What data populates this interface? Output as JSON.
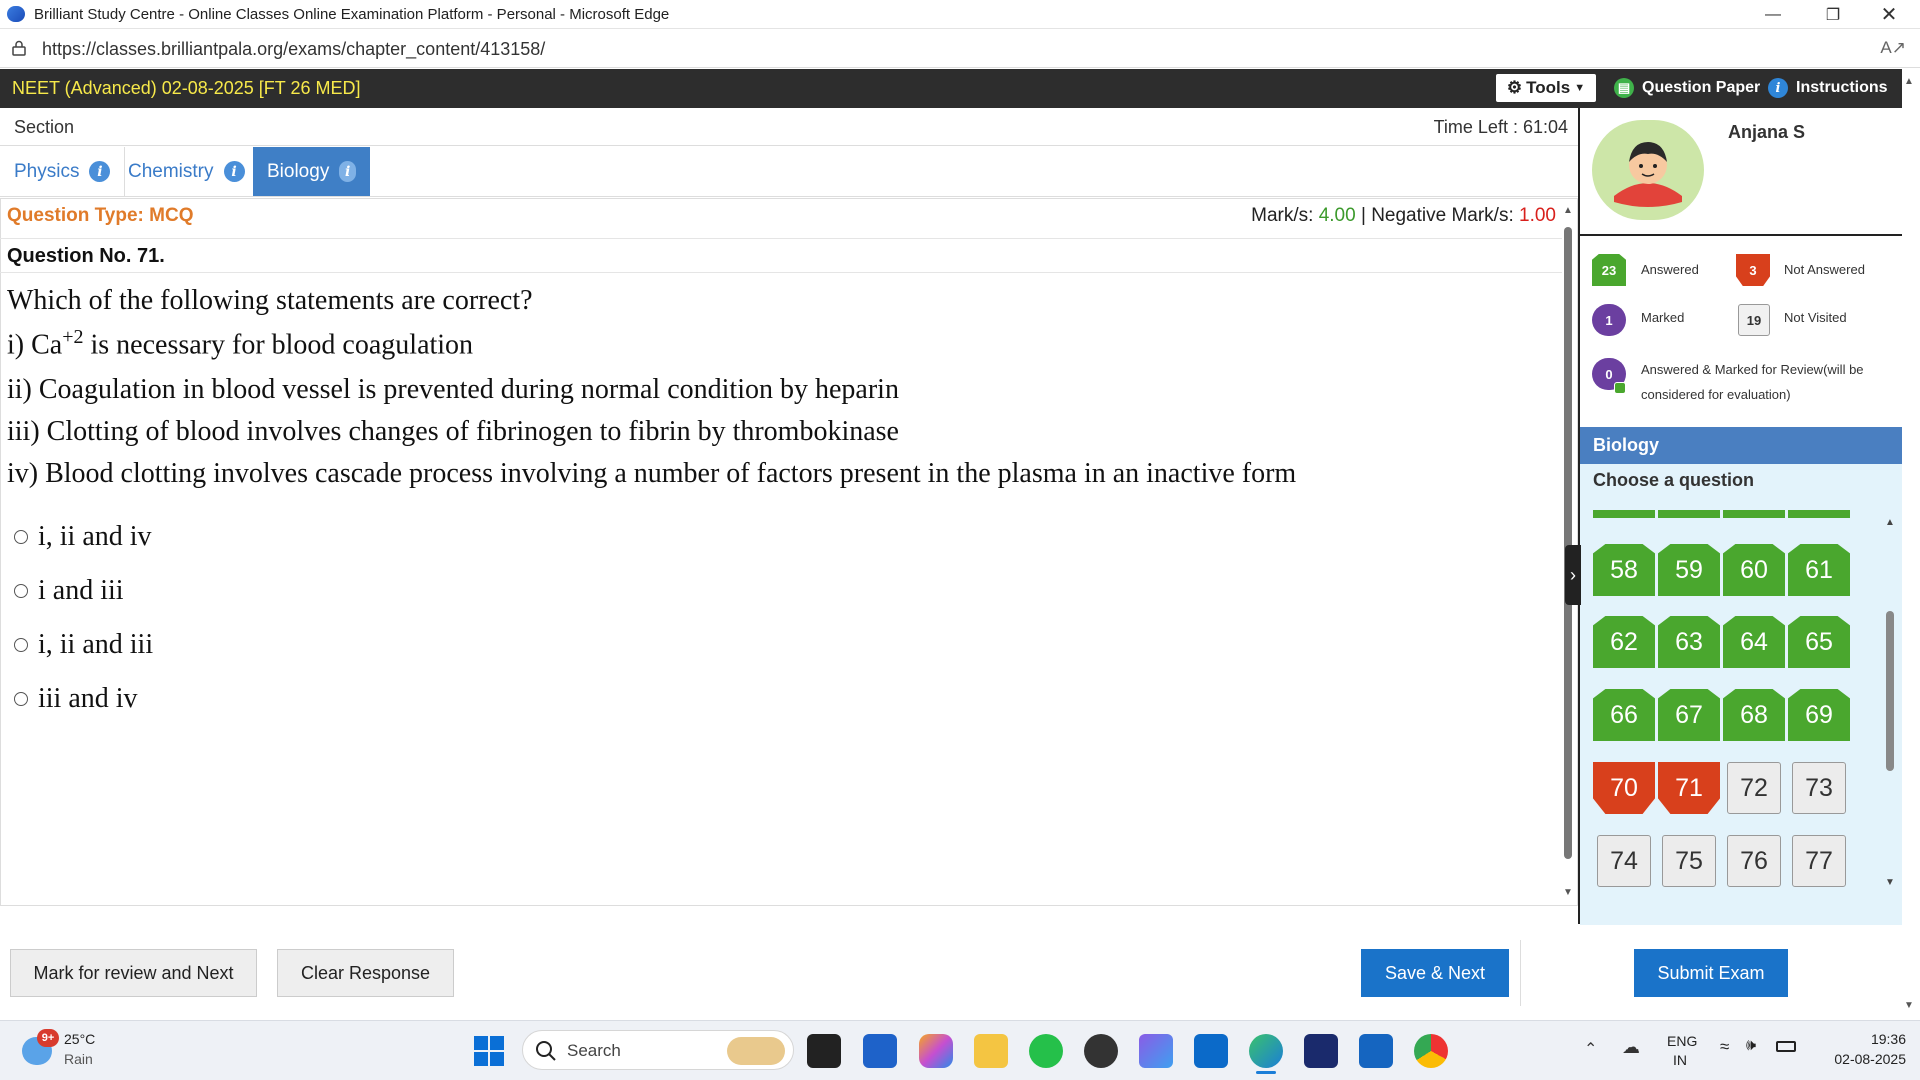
{
  "browser": {
    "title": "Brilliant Study Centre - Online Classes Online Examination Platform - Personal - Microsoft Edge",
    "url": "https://classes.brilliantpala.org/exams/chapter_content/413158/"
  },
  "header": {
    "exam_title": "NEET (Advanced) 02-08-2025 [FT 26 MED]",
    "tools_label": "Tools",
    "question_paper_label": "Question Paper",
    "instructions_label": "Instructions"
  },
  "section": {
    "label": "Section",
    "time_left": "Time Left : 61:04",
    "tabs": [
      {
        "label": "Physics",
        "active": false
      },
      {
        "label": "Chemistry",
        "active": false
      },
      {
        "label": "Biology",
        "active": true
      }
    ]
  },
  "question": {
    "type_label": "Question Type: MCQ",
    "marks_label": "Mark/s:",
    "marks_value": "4.00",
    "negative_label": "Negative Mark/s:",
    "negative_value": "1.00",
    "number": "Question No. 71.",
    "text_lines": {
      "l0": "Which of the following statements are correct?",
      "l1a": "i) Ca",
      "l1sup": "+2",
      "l1b": " is necessary for blood coagulation",
      "l2": "ii) Coagulation in blood vessel is prevented during normal condition by heparin",
      "l3": "iii) Clotting of blood involves changes of fibrinogen to fibrin by thrombokinase",
      "l4": "iv) Blood clotting involves cascade process involving a number of factors present in the plasma in an inactive form"
    },
    "options": [
      "i, ii and iv",
      "i and iii",
      "i, ii and iii",
      "iii and iv"
    ]
  },
  "footer": {
    "mark_review": "Mark for review and Next",
    "clear": "Clear Response",
    "save_next": "Save & Next",
    "submit": "Submit Exam"
  },
  "profile": {
    "name": "Anjana S"
  },
  "legend": {
    "answered_count": "23",
    "answered_label": "Answered",
    "not_answered_count": "3",
    "not_answered_label": "Not Answered",
    "marked_count": "1",
    "marked_label": "Marked",
    "not_visited_count": "19",
    "not_visited_label": "Not Visited",
    "ans_marked_count": "0",
    "ans_marked_label": "Answered & Marked for Review(will be",
    "ans_marked_label2": "considered for evaluation)"
  },
  "palette": {
    "subject": "Biology",
    "choose_label": "Choose a question",
    "rows": [
      [
        {
          "n": "58",
          "s": "ans"
        },
        {
          "n": "59",
          "s": "ans"
        },
        {
          "n": "60",
          "s": "ans"
        },
        {
          "n": "61",
          "s": "ans"
        }
      ],
      [
        {
          "n": "62",
          "s": "ans"
        },
        {
          "n": "63",
          "s": "ans"
        },
        {
          "n": "64",
          "s": "ans"
        },
        {
          "n": "65",
          "s": "ans"
        }
      ],
      [
        {
          "n": "66",
          "s": "ans"
        },
        {
          "n": "67",
          "s": "ans"
        },
        {
          "n": "68",
          "s": "ans"
        },
        {
          "n": "69",
          "s": "ans"
        }
      ],
      [
        {
          "n": "70",
          "s": "nans"
        },
        {
          "n": "71",
          "s": "nans"
        },
        {
          "n": "72",
          "s": "nv"
        },
        {
          "n": "73",
          "s": "nv"
        }
      ],
      [
        {
          "n": "74",
          "s": "nv"
        },
        {
          "n": "75",
          "s": "nv"
        },
        {
          "n": "76",
          "s": "nv"
        },
        {
          "n": "77",
          "s": "nv"
        }
      ]
    ]
  },
  "taskbar": {
    "weather_temp": "25°C",
    "weather_desc": "Rain",
    "weather_badge": "9+",
    "search_placeholder": "Search",
    "lang1": "ENG",
    "lang2": "IN",
    "time": "19:36",
    "date": "02-08-2025"
  },
  "colors": {
    "answered": "#4aa72e",
    "not_answered": "#d8401c",
    "marked": "#6b3fa0",
    "primary": "#1a73c9",
    "question_type": "#e07b2a"
  }
}
